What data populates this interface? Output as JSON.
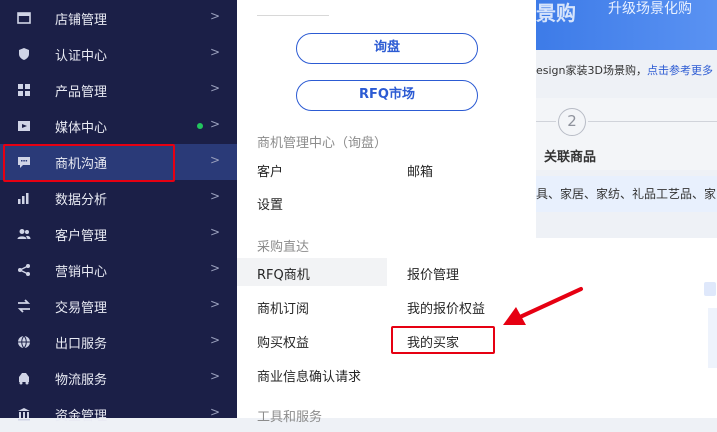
{
  "sidebar": {
    "items": [
      {
        "label": "店铺管理",
        "icon": "store-icon"
      },
      {
        "label": "认证中心",
        "icon": "shield-icon"
      },
      {
        "label": "产品管理",
        "icon": "grid-icon"
      },
      {
        "label": "媒体中心",
        "icon": "media-icon"
      },
      {
        "label": "商机沟通",
        "icon": "chat-icon"
      },
      {
        "label": "数据分析",
        "icon": "bar-chart-icon"
      },
      {
        "label": "客户管理",
        "icon": "users-icon"
      },
      {
        "label": "营销中心",
        "icon": "share-icon"
      },
      {
        "label": "交易管理",
        "icon": "trade-icon"
      },
      {
        "label": "出口服务",
        "icon": "globe-icon"
      },
      {
        "label": "物流服务",
        "icon": "truck-icon"
      },
      {
        "label": "资金管理",
        "icon": "bank-icon"
      }
    ],
    "chevron": ">"
  },
  "dropdown": {
    "inquiry_button": "询盘",
    "rfq_market_button": "RFQ市场",
    "section1_title": "商机管理中心（询盘）",
    "customer": "客户",
    "mailbox": "邮箱",
    "settings": "设置",
    "section2_title": "采购直达",
    "rfq_opportunity": "RFQ商机",
    "quote_management": "报价管理",
    "opportunity_subscription": "商机订阅",
    "my_quote_rights": "我的报价权益",
    "buy_rights": "购买权益",
    "my_buyers": "我的买家",
    "business_info_confirm": "商业信息确认请求",
    "section3_title": "工具和服务"
  },
  "right": {
    "banner_title": "景购",
    "banner_subtitle": "升级场景化购",
    "info_text": "esign家装3D场景购，",
    "info_link": "点击参考更多",
    "step_number": "2",
    "step_label": "关联商品",
    "categories": "具、家居、家纺、礼品工艺品、家电"
  },
  "colors": {
    "sidebar_bg": "#1b1f47",
    "sidebar_active_bg": "#2a3a78",
    "accent_blue": "#2c5bd3",
    "highlight_red": "#e60012",
    "status_green": "#22c55e"
  }
}
